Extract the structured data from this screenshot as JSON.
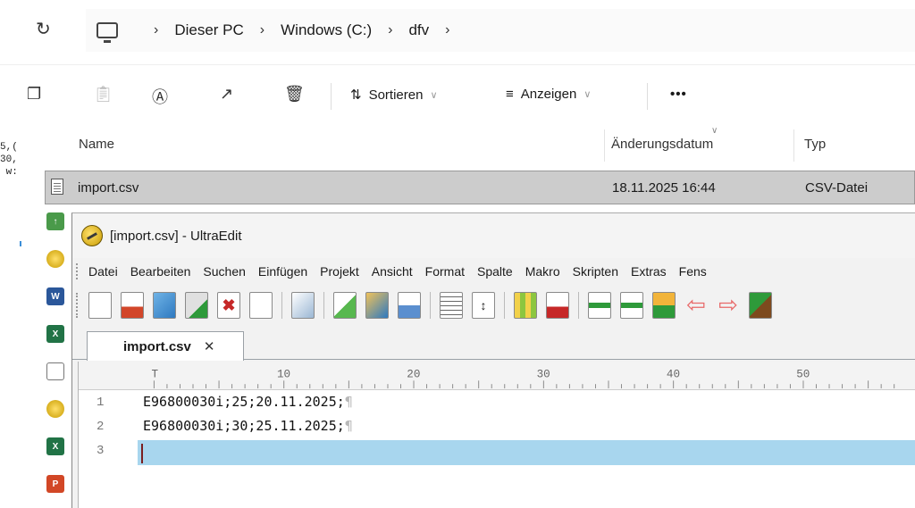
{
  "explorer": {
    "breadcrumb": [
      "Dieser PC",
      "Windows (C:)",
      "dfv"
    ],
    "commands": {
      "sort_label": "Sortieren",
      "view_label": "Anzeigen",
      "more_label": "•••"
    },
    "columns": {
      "name": "Name",
      "date": "Änderungsdatum",
      "type": "Typ"
    },
    "files": [
      {
        "name": "import.csv",
        "date": "18.11.2025 16:44",
        "type": "CSV-Datei"
      }
    ],
    "left_code_fragment": [
      "5,(",
      "30,",
      " w:"
    ]
  },
  "ultraedit": {
    "title": "[import.csv] - UltraEdit",
    "menu": [
      "Datei",
      "Bearbeiten",
      "Suchen",
      "Einfügen",
      "Projekt",
      "Ansicht",
      "Format",
      "Spalte",
      "Makro",
      "Skripten",
      "Extras",
      "Fens"
    ],
    "tab": {
      "label": "import.csv",
      "close": "✕"
    },
    "ruler": [
      "T",
      "10",
      "20",
      "30",
      "40",
      "50"
    ],
    "lines": [
      {
        "no": "1",
        "text": "E96800030i;25;20.11.2025;"
      },
      {
        "no": "2",
        "text": "E96800030i;30;25.11.2025;"
      },
      {
        "no": "3",
        "text": ""
      }
    ],
    "eol_mark": "¶"
  },
  "colors": {
    "selection_row": "#cccccc",
    "current_line": "#a8d6ee",
    "caret": "#7a1f1f",
    "toolbar_red_arrow": "#e86a6a",
    "toolbar_green": "#2e9a3a"
  }
}
